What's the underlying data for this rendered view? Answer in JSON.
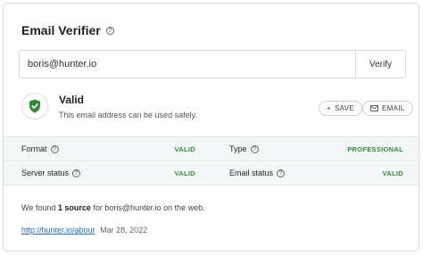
{
  "header": {
    "title": "Email Verifier"
  },
  "search": {
    "value": "boris@hunter.io",
    "verify_label": "Verify"
  },
  "result": {
    "status": "Valid",
    "description": "This email address can be used safely.",
    "save_label": "SAVE",
    "email_label": "EMAIL"
  },
  "details": {
    "format_label": "Format",
    "format_value": "VALID",
    "type_label": "Type",
    "type_value": "PROFESSIONAL",
    "server_label": "Server status",
    "server_value": "VALID",
    "email_status_label": "Email status",
    "email_status_value": "VALID"
  },
  "sources": {
    "prefix": "We found ",
    "count": "1 source",
    "suffix": " for boris@hunter.io on the web.",
    "items": [
      {
        "url": "http://hunter.io/about",
        "date": "Mar 28, 2022"
      }
    ]
  },
  "colors": {
    "valid_green": "#2e8b3a",
    "link_blue": "#2a6fbf"
  },
  "icons": [
    "help-icon",
    "shield-check-icon",
    "plus-icon",
    "envelope-icon"
  ]
}
